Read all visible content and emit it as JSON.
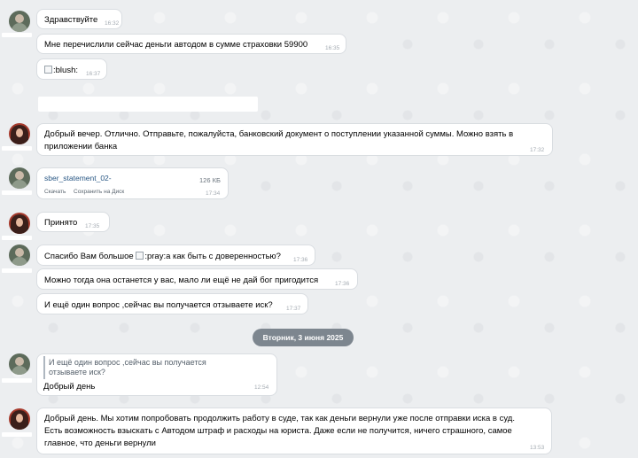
{
  "messages": {
    "m1": {
      "text": "Здравствуйте",
      "time": "16:32"
    },
    "m2": {
      "text": "Мне перечислили сейчас деньги автодом в сумме страховки 59900",
      "time": "16:35"
    },
    "m3": {
      "alt": ":blush:",
      "time": "16:37"
    },
    "m4": {
      "line1": "Добрый вечер. Отлично. Отправьте, пожалуйста, банковский документ о поступлении указанной суммы. Можно взять в",
      "line2": "приложении банка",
      "time": "17:32"
    },
    "m5": {
      "file_name": "sber_statement_02-",
      "file_size": "126 КБ",
      "download": "Скачать",
      "save_disk": "Сохранить на Диск",
      "time": "17:34"
    },
    "m6": {
      "text": "Принято",
      "time": "17:35"
    },
    "m7": {
      "before": "Спасибо Вам большое ",
      "alt": ":pray:",
      "after": "а как быть с доверенностью?",
      "time": "17:36"
    },
    "m8": {
      "text": "Можно тогда она останется у вас, мало ли ещё не дай бог пригодится",
      "time": "17:36"
    },
    "m9": {
      "text": "И ещё один вопрос ,сейчас вы получается отзываете иск?",
      "time": "17:37"
    },
    "date_separator": "Вторник, 3 июня 2025",
    "m10": {
      "quote_line1": "И ещё один вопрос ,сейчас вы получается",
      "quote_line2": "отзываете иск?",
      "text": "Добрый день",
      "time": "12:54"
    },
    "m11": {
      "line1": "Добрый день. Мы хотим попробовать продолжить работу в суде, так как деньги вернули уже после отправки иска в суд.",
      "line2": "Есть возможность взыскать с Автодом штраф и расходы на юриста. Даже если не получится, ничего страшного, самое",
      "line3": "главное, что деньги вернули",
      "time": "13:53"
    }
  }
}
